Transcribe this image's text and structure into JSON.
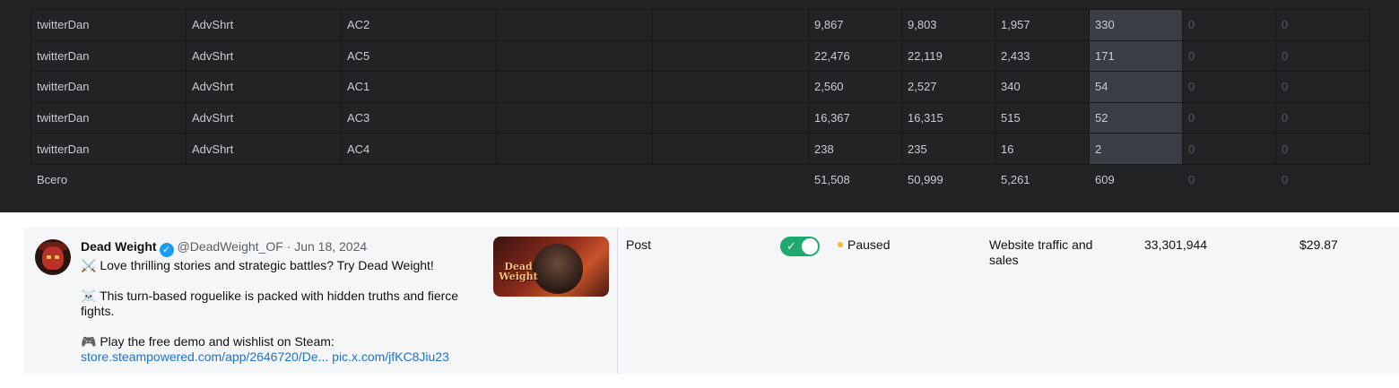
{
  "stats_table": {
    "rows": [
      {
        "user": "twitterDan",
        "campaign": "AdvShrt",
        "ad": "AC2",
        "c4": "",
        "c5": "",
        "v1": "9,867",
        "v2": "9,803",
        "v3": "1,957",
        "v4": "330",
        "v5": "0",
        "v6": "0"
      },
      {
        "user": "twitterDan",
        "campaign": "AdvShrt",
        "ad": "AC5",
        "c4": "",
        "c5": "",
        "v1": "22,476",
        "v2": "22,119",
        "v3": "2,433",
        "v4": "171",
        "v5": "0",
        "v6": "0"
      },
      {
        "user": "twitterDan",
        "campaign": "AdvShrt",
        "ad": "AC1",
        "c4": "",
        "c5": "",
        "v1": "2,560",
        "v2": "2,527",
        "v3": "340",
        "v4": "54",
        "v5": "0",
        "v6": "0"
      },
      {
        "user": "twitterDan",
        "campaign": "AdvShrt",
        "ad": "AC3",
        "c4": "",
        "c5": "",
        "v1": "16,367",
        "v2": "16,315",
        "v3": "515",
        "v4": "52",
        "v5": "0",
        "v6": "0"
      },
      {
        "user": "twitterDan",
        "campaign": "AdvShrt",
        "ad": "AC4",
        "c4": "",
        "c5": "",
        "v1": "238",
        "v2": "235",
        "v3": "16",
        "v4": "2",
        "v5": "0",
        "v6": "0"
      }
    ],
    "total": {
      "label": "Всего",
      "v1": "51,508",
      "v2": "50,999",
      "v3": "5,261",
      "v4": "609",
      "v5": "0",
      "v6": "0"
    },
    "colors": {
      "background": "#222325",
      "highlight": "#3a3d43",
      "text": "#c9cbce"
    }
  },
  "ad_row": {
    "tweet": {
      "name": "Dead Weight",
      "handle_date": "@DeadWeight_OF · Jun 18, 2024",
      "line1": "⚔️ Love thrilling stories and strategic battles? Try Dead Weight!",
      "line2": "☠️ This turn-based roguelike is packed with hidden truths and fierce fights.",
      "line3": "🎮 Play the free demo and wishlist on Steam:",
      "link": "store.steampowered.com/app/2646720/De... pic.x.com/jfKC8Jiu23",
      "thumbnail_text": "Dead Weight"
    },
    "type": "Post",
    "toggle_on": true,
    "status": "Paused",
    "objective": "Website traffic and sales",
    "impressions": "33,301,944",
    "spend": "$29.87",
    "colors": {
      "toggle": "#1faa6d",
      "status_dot": "#f5b82e",
      "link": "#1d73c9",
      "verified": "#1d9bf0"
    }
  }
}
